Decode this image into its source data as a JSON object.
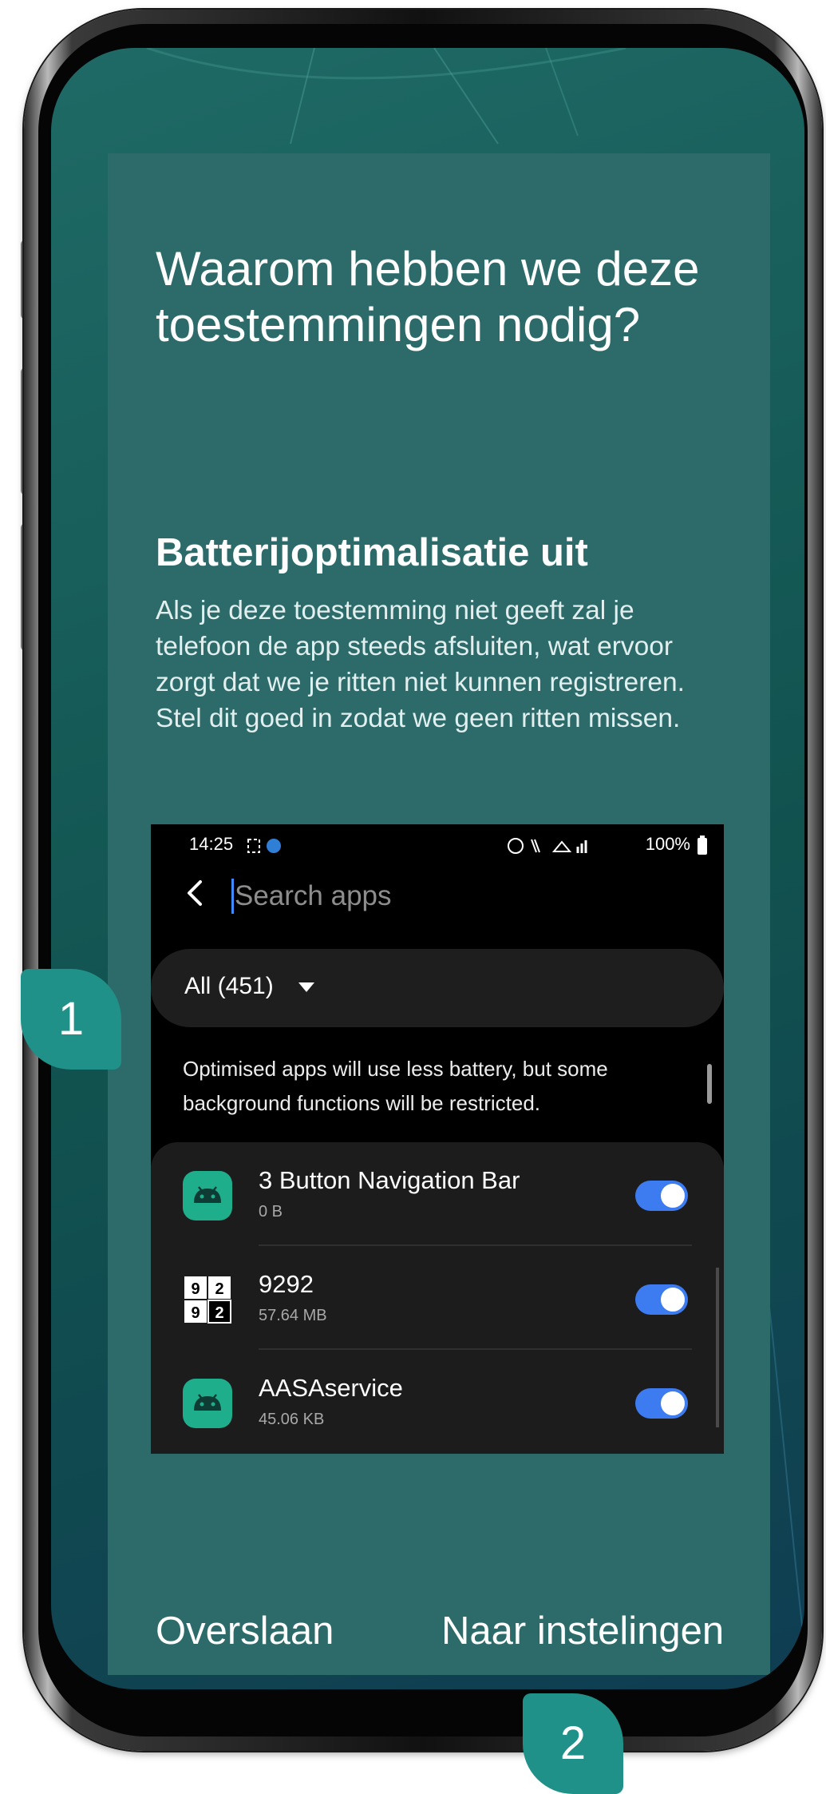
{
  "colors": {
    "card_background": "#2d6b6b",
    "screen_background": "#1f6a66",
    "badge_background": "#1f9188",
    "toggle_on": "#3d7cf0",
    "text_primary": "#ffffff"
  },
  "onboarding": {
    "title": "Waarom hebben we deze toestemmingen nodig?",
    "subtitle": "Batterijoptimalisatie uit",
    "description": "Als je deze toestemming niet geeft zal je telefoon de app steeds afsluiten, wat ervoor zorgt dat we je ritten niet kunnen registreren. Stel dit goed in zodat we geen ritten missen.",
    "skip_label": "Overslaan",
    "settings_label": "Naar instelingen"
  },
  "screenshot": {
    "status_time": "14:25",
    "status_right": "100%",
    "search_placeholder": "Search apps",
    "filter_label": "All (451)",
    "info_text": "Optimised apps will use less battery, but some background functions will be restricted.",
    "apps": [
      {
        "name": "3 Button Navigation Bar",
        "size": "0 B",
        "icon": "android-icon",
        "enabled": true
      },
      {
        "name": "9292",
        "size": "57.64 MB",
        "icon": "9292-app-icon",
        "enabled": true
      },
      {
        "name": "AASAservice",
        "size": "45.06 KB",
        "icon": "android-icon",
        "enabled": true
      }
    ]
  },
  "callouts": {
    "badge_1": "1",
    "badge_2": "2"
  }
}
